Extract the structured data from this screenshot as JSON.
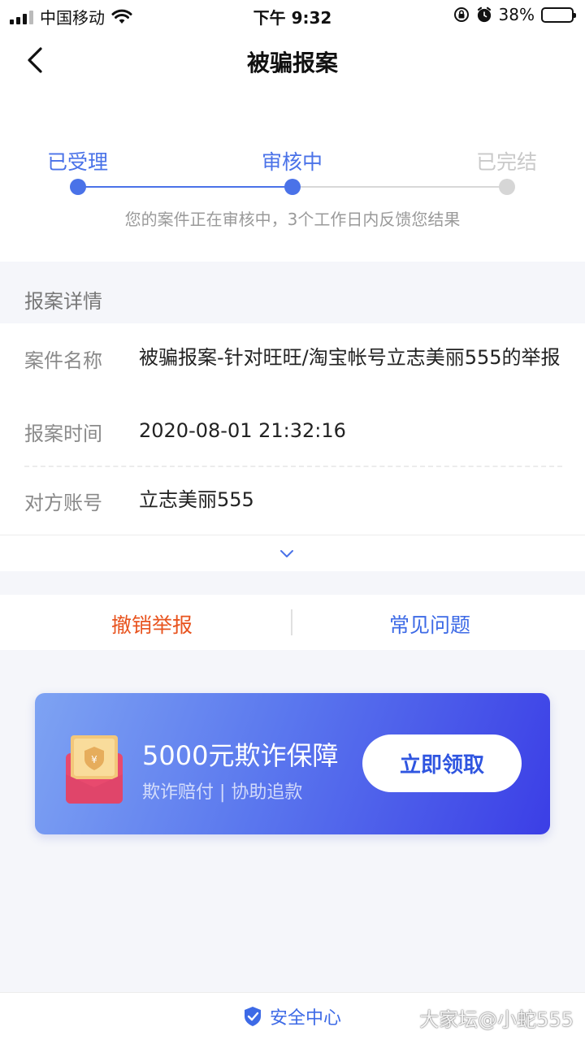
{
  "status_bar": {
    "carrier": "中国移动",
    "time": "下午 9:32",
    "battery": "38%",
    "battery_level": 0.38,
    "icons": [
      "signal-icon",
      "wifi-icon",
      "orientation-lock-icon",
      "alarm-icon",
      "battery-icon"
    ]
  },
  "nav": {
    "title": "被骗报案",
    "back_icon": "chevron-left-icon"
  },
  "progress": {
    "steps": [
      {
        "label": "已受理",
        "state": "done"
      },
      {
        "label": "审核中",
        "state": "current"
      },
      {
        "label": "已完结",
        "state": "pending"
      }
    ],
    "hint": "您的案件正在审核中，3个工作日内反馈您结果"
  },
  "details": {
    "section_title": "报案详情",
    "rows": [
      {
        "label": "案件名称",
        "value": "被骗报案-针对旺旺/淘宝帐号立志美丽555的举报"
      },
      {
        "label": "报案时间",
        "value": "2020-08-01 21:32:16"
      },
      {
        "label": "对方账号",
        "value": "立志美丽555"
      }
    ],
    "expand_icon": "chevron-down-icon"
  },
  "actions": {
    "revoke": "撤销举报",
    "faq": "常见问题"
  },
  "banner": {
    "title": "5000元欺诈保障",
    "subtitle": "欺诈赔付 | 协助追款",
    "button": "立即领取",
    "icon": "red-envelope-icon"
  },
  "footer": {
    "brand": "安全中心",
    "brand_icon": "shield-check-icon"
  },
  "watermark": "大家坛@小蛇555",
  "colors": {
    "accent": "#4a72e8",
    "revoke": "#e8531e",
    "inactive": "#d6d6d6",
    "banner_start": "#7ea3f3",
    "banner_end": "#3b3ee6"
  }
}
